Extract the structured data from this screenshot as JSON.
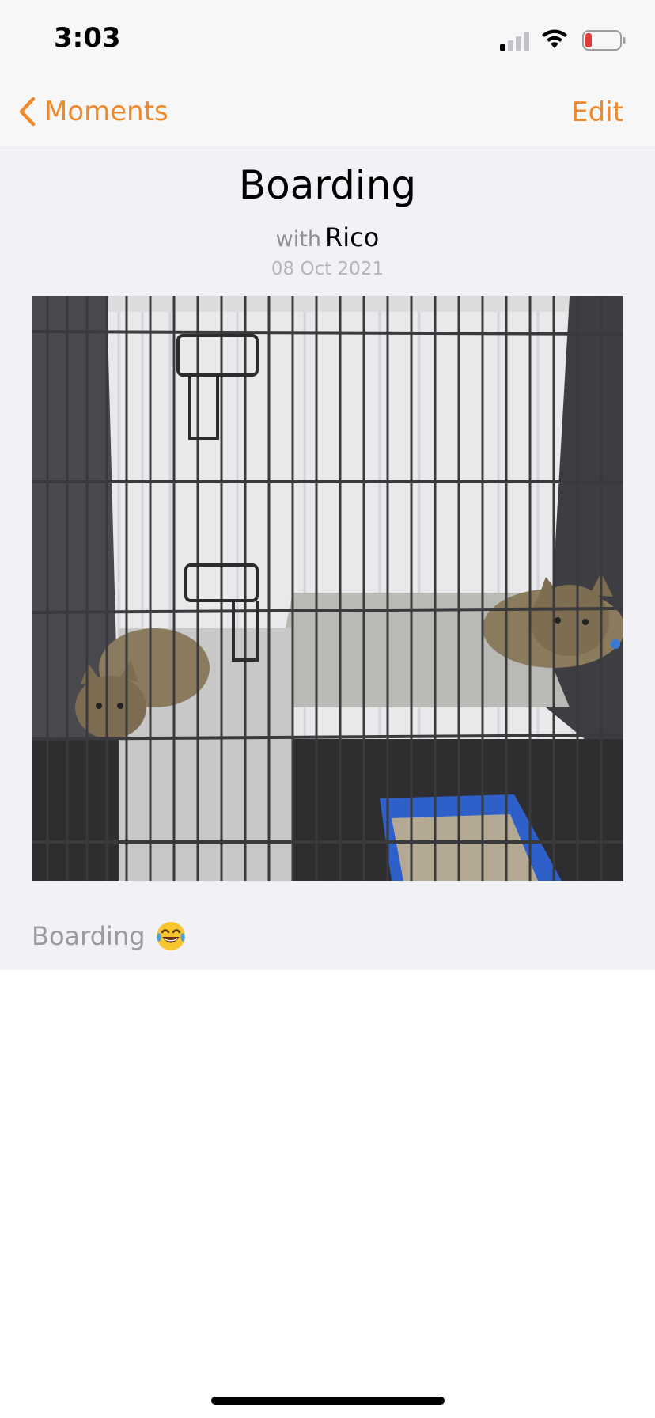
{
  "status_bar": {
    "time": "3:03",
    "icons": [
      "cellular-signal-icon",
      "wifi-icon",
      "battery-low-icon"
    ]
  },
  "nav": {
    "back_label": "Moments",
    "edit_label": "Edit",
    "accent_color": "#ef8a2c"
  },
  "moment": {
    "title": "Boarding",
    "with_word": "with",
    "with_name": "Rico",
    "date": "08 Oct 2021",
    "caption_text": "Boarding",
    "caption_emoji": "😂",
    "photo_icon": "cat-cage-photo"
  }
}
